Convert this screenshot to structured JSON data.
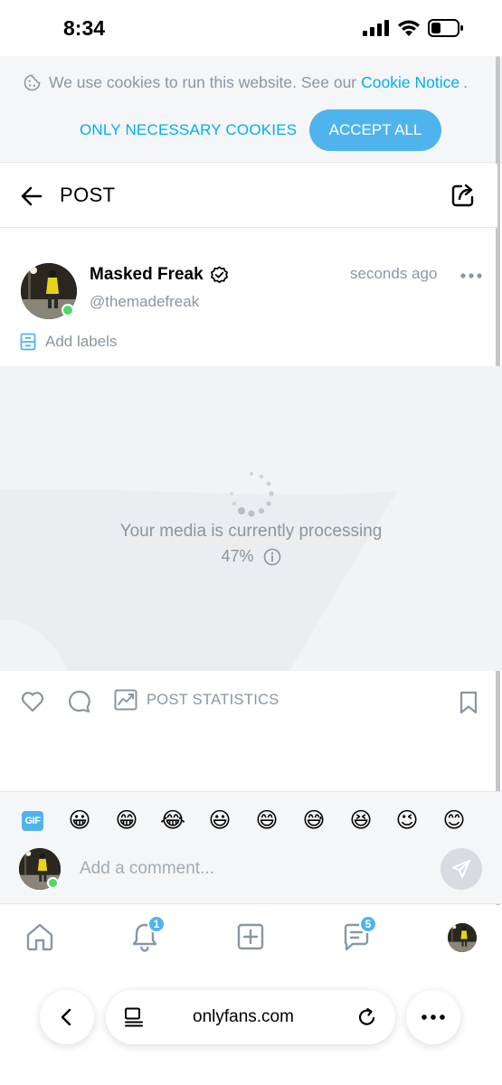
{
  "status_bar": {
    "time": "8:34"
  },
  "cookie_banner": {
    "text": "We use cookies to run this website. See our",
    "link_text": "Cookie Notice",
    "link_suffix": ".",
    "necessary_label": "ONLY NECESSARY COOKIES",
    "accept_label": "ACCEPT ALL"
  },
  "header": {
    "title": "POST"
  },
  "post": {
    "author_name": "Masked Freak",
    "author_handle": "@themadefreak",
    "time": "seconds ago",
    "labels_text": "Add labels",
    "media_status": "Your media is currently processing",
    "media_progress": "47%",
    "statistics_label": "POST STATISTICS"
  },
  "comment": {
    "gif_label": "GIF",
    "emojis": [
      "😀",
      "😁",
      "😂",
      "😃",
      "😄",
      "😅",
      "😆",
      "😉",
      "😊"
    ],
    "placeholder": "Add a comment..."
  },
  "bottom_nav": {
    "items": [
      "home-icon",
      "notifications-icon",
      "add-post-icon",
      "messages-icon",
      "profile-avatar"
    ],
    "notifications_badge": "1",
    "messages_badge": "5"
  },
  "browser": {
    "url": "onlyfans.com"
  },
  "colors": {
    "accent": "#00aff0",
    "button": "#4fb4ed",
    "muted": "#8a96a3",
    "online": "#4cd964"
  }
}
